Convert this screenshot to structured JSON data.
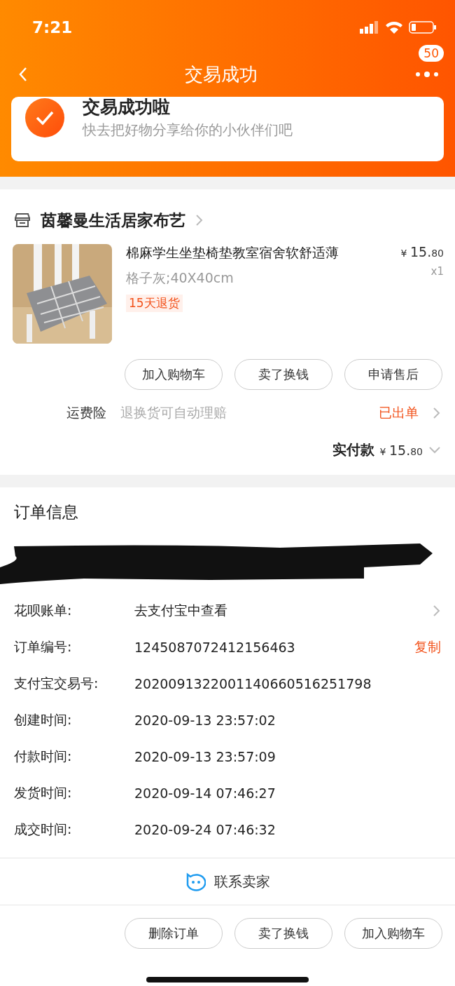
{
  "status_bar": {
    "time": "7:21"
  },
  "nav": {
    "title": "交易成功",
    "badge": "50"
  },
  "banner": {
    "title": "交易成功啦",
    "subtitle": "快去把好物分享给你的小伙伴们吧"
  },
  "shop": {
    "name": "茵馨曼生活居家布艺"
  },
  "product": {
    "title": "棉麻学生坐垫椅垫教室宿舍软舒适薄",
    "sku": "格子灰;40X40cm",
    "tag": "15天退货",
    "currency": "¥",
    "price_int": "15.",
    "price_dec": "80",
    "quantity": "x1"
  },
  "product_actions": [
    "加入购物车",
    "卖了换钱",
    "申请售后"
  ],
  "insurance": {
    "label": "运费险",
    "desc": "退换货可自动理赔",
    "status": "已出单"
  },
  "total": {
    "label": "实付款",
    "currency": "¥",
    "price_int": "15.",
    "price_dec": "80"
  },
  "order_info": {
    "title": "订单信息",
    "rows": [
      {
        "label": "花呗账单:",
        "value": "去支付宝中查看",
        "kind": "link"
      },
      {
        "label": "订单编号:",
        "value": "1245087072412156463",
        "kind": "copy",
        "action": "复制"
      },
      {
        "label": "支付宝交易号:",
        "value": "2020091322001140660516251798",
        "kind": "plain"
      },
      {
        "label": "创建时间:",
        "value": "2020-09-13 23:57:02",
        "kind": "plain"
      },
      {
        "label": "付款时间:",
        "value": "2020-09-13 23:57:09",
        "kind": "plain"
      },
      {
        "label": "发货时间:",
        "value": "2020-09-14 07:46:27",
        "kind": "plain"
      },
      {
        "label": "成交时间:",
        "value": "2020-09-24 07:46:32",
        "kind": "plain"
      }
    ]
  },
  "contact": {
    "label": "联系卖家"
  },
  "bottom_actions": [
    "删除订单",
    "卖了换钱",
    "加入购物车"
  ]
}
